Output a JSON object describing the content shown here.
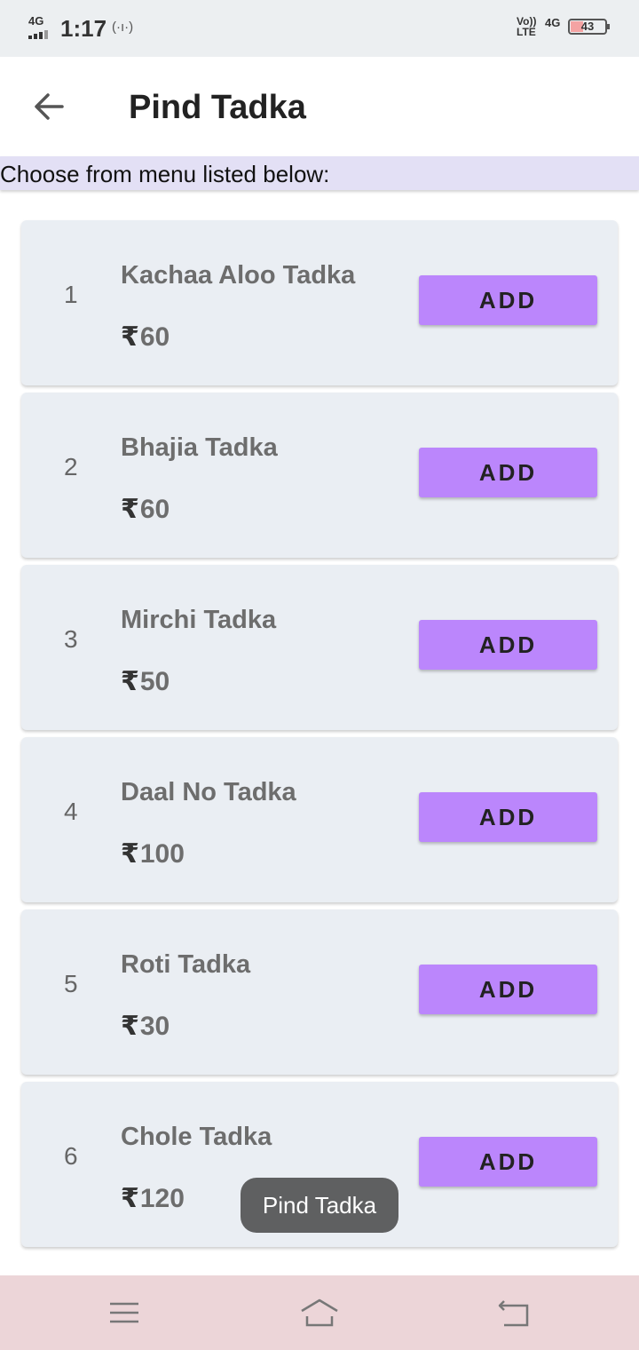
{
  "status_bar": {
    "network": "4G",
    "time": "1:17",
    "hotspot_icon": "(·ı·)",
    "volte_top": "Vo))",
    "volte_bottom": "LTE",
    "network_right": "4G",
    "battery": "43"
  },
  "app_bar": {
    "title": "Pind Tadka",
    "back_icon": "arrow-left-icon"
  },
  "subheader": "Choose from menu listed below:",
  "currency": "₹",
  "menu": [
    {
      "index": "1",
      "name": "Kachaa Aloo Tadka",
      "price": "60",
      "button": "ADD"
    },
    {
      "index": "2",
      "name": "Bhajia Tadka",
      "price": "60",
      "button": "ADD"
    },
    {
      "index": "3",
      "name": "Mirchi Tadka",
      "price": "50",
      "button": "ADD"
    },
    {
      "index": "4",
      "name": "Daal No Tadka",
      "price": "100",
      "button": "ADD"
    },
    {
      "index": "5",
      "name": "Roti Tadka",
      "price": "30",
      "button": "ADD"
    },
    {
      "index": "6",
      "name": "Chole Tadka",
      "price": "120",
      "button": "ADD"
    }
  ],
  "toast": "Pind Tadka",
  "nav_bar": {
    "icons": [
      "menu-icon",
      "home-icon",
      "back-icon"
    ]
  },
  "colors": {
    "accent": "#bb86fc",
    "subheader_bg": "#e3e0f5",
    "card_bg": "#eaeef3",
    "nav_bg": "#ecd5d8"
  }
}
